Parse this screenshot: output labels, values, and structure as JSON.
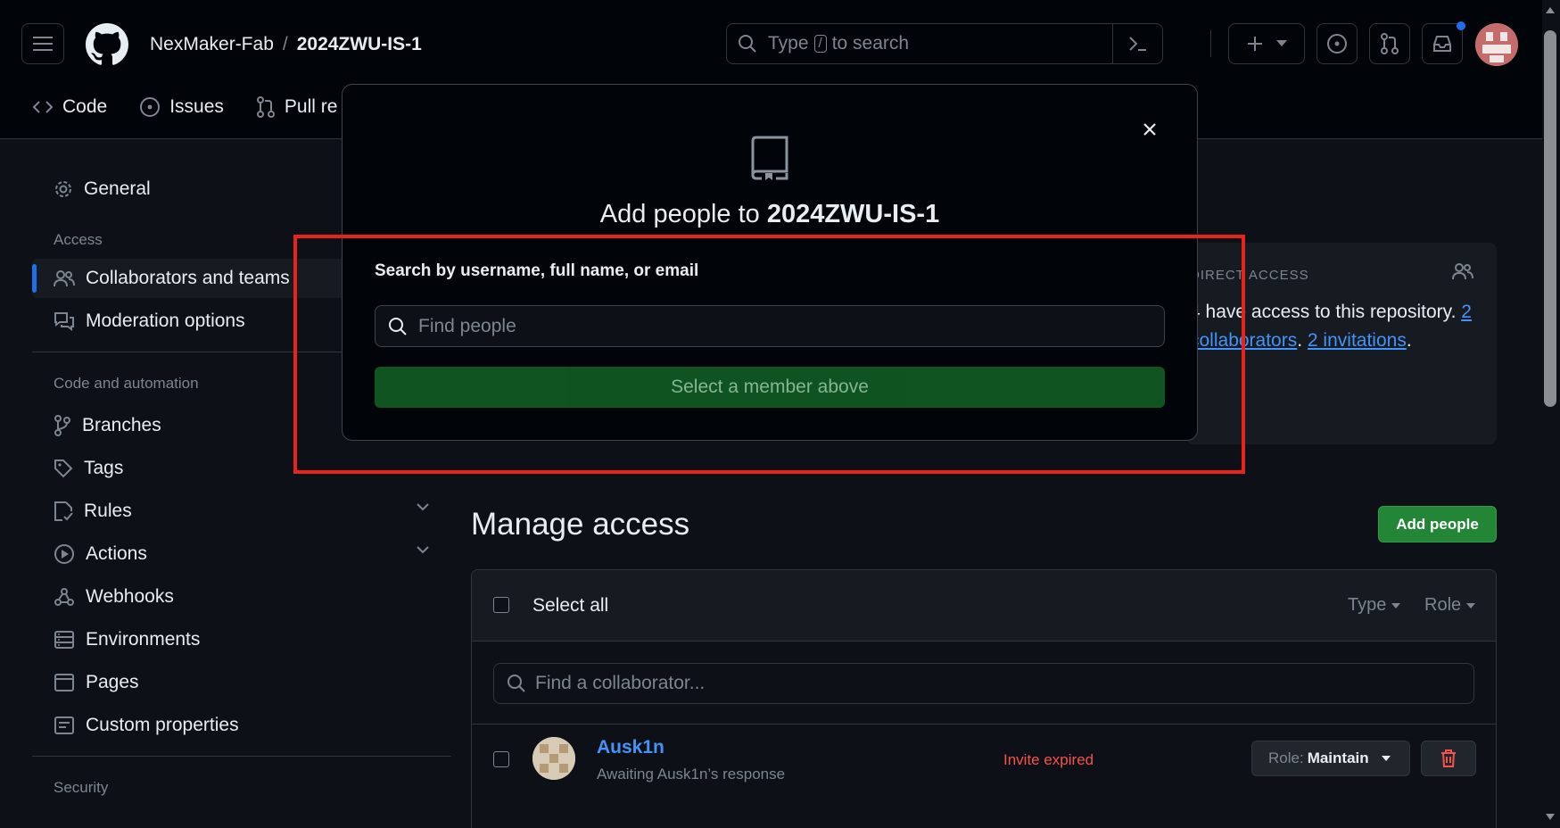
{
  "header": {
    "owner": "NexMaker-Fab",
    "separator": "/",
    "repo": "2024ZWU-IS-1",
    "search_prefix": "Type",
    "search_key": "/",
    "search_suffix": "to search"
  },
  "tabs": [
    {
      "label": "Code",
      "icon": "code-icon"
    },
    {
      "label": "Issues",
      "icon": "issue-icon"
    },
    {
      "label": "Pull re",
      "icon": "pull-request-icon"
    }
  ],
  "sidebar": {
    "general": "General",
    "access_section": "Access",
    "access_items": [
      "Collaborators and teams",
      "Moderation options"
    ],
    "code_section": "Code and automation",
    "code_items": [
      "Branches",
      "Tags",
      "Rules",
      "Actions",
      "Webhooks",
      "Environments",
      "Pages",
      "Custom properties"
    ],
    "security_section": "Security"
  },
  "access_box": {
    "title": "DIRECT ACCESS",
    "line1_text": "4 have access to this repository.",
    "line1_link": "2",
    "line2_link_a": "collaborators",
    "line2_dot": ".",
    "line2_link_b": "2 invitations",
    "line2_end": "."
  },
  "manage": {
    "title": "Manage access",
    "add_button": "Add people",
    "select_all": "Select all",
    "type_filter": "Type",
    "role_filter": "Role",
    "find_placeholder": "Find a collaborator...",
    "rows": [
      {
        "name": "Ausk1n",
        "sub": "Awaiting Ausk1n’s response",
        "status": "Invite expired",
        "role_label": "Role:",
        "role_value": "Maintain"
      }
    ]
  },
  "modal": {
    "title_prefix": "Add people to",
    "title_repo": "2024ZWU-IS-1",
    "search_label": "Search by username, full name, or email",
    "input_placeholder": "Find people",
    "submit_label": "Select a member above"
  },
  "colors": {
    "background": "#0d1117",
    "accent": "#1f6feb",
    "primary_button": "#238636",
    "danger": "#f85149",
    "highlight_box": "#e8231a"
  }
}
